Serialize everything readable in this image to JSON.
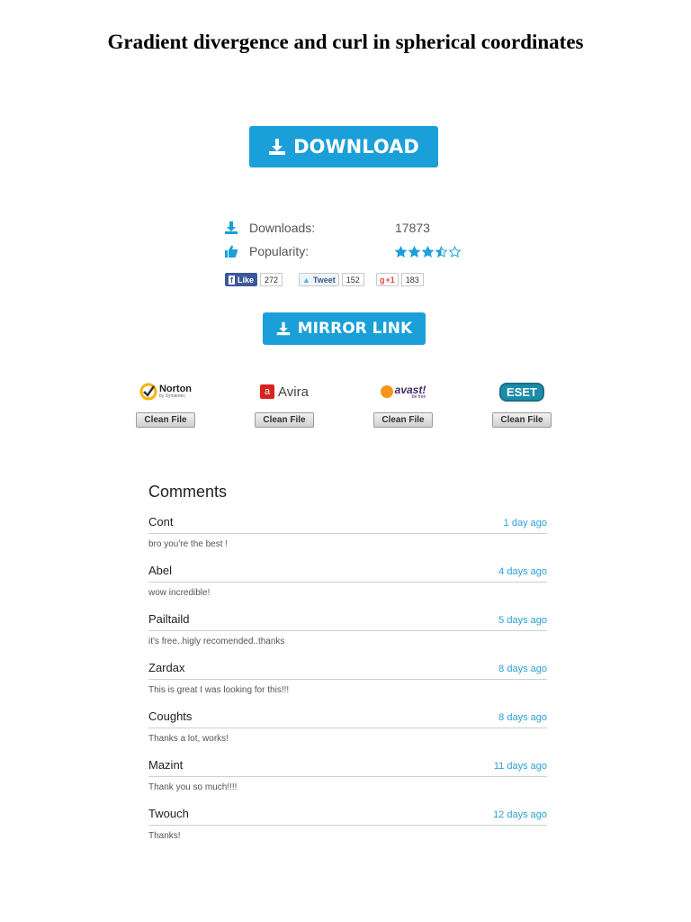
{
  "header": {
    "title": "Gradient divergence and curl in spherical coordinates"
  },
  "download_button": {
    "label": "DOWNLOAD",
    "icon": "download-icon",
    "color": "#1a9fd9"
  },
  "stats": {
    "downloads_label": "Downloads:",
    "downloads_value": "17873",
    "popularity_label": "Popularity:",
    "popularity_rating": 3.5,
    "popularity_max": 5
  },
  "social": {
    "facebook": {
      "label": "Like",
      "count": "272"
    },
    "twitter": {
      "label": "Tweet",
      "count": "152"
    },
    "google": {
      "label": "+1",
      "count": "183"
    }
  },
  "mirror_button": {
    "label": "MIRROR LINK",
    "icon": "download-icon"
  },
  "antivirus": [
    {
      "name": "Norton",
      "sub": "by Symantec",
      "button": "Clean File"
    },
    {
      "name": "Avira",
      "button": "Clean File"
    },
    {
      "name": "avast!",
      "sub": "be free",
      "button": "Clean File"
    },
    {
      "name": "ESET",
      "button": "Clean File"
    }
  ],
  "comments": {
    "title": "Comments",
    "items": [
      {
        "author": "Cont",
        "time": "1 day ago",
        "text": "bro you're the best !"
      },
      {
        "author": "Abel",
        "time": "4 days ago",
        "text": "wow incredible!"
      },
      {
        "author": "Pailtaild",
        "time": "5 days ago",
        "text": "it's free..higly recomended..thanks"
      },
      {
        "author": "Zardax",
        "time": "8 days ago",
        "text": "This is great I was looking for this!!!"
      },
      {
        "author": "Coughts",
        "time": "8 days ago",
        "text": "Thanks a lot, works!"
      },
      {
        "author": "Mazint",
        "time": "11 days ago",
        "text": "Thank you so much!!!!"
      },
      {
        "author": "Twouch",
        "time": "12 days ago",
        "text": "Thanks!"
      }
    ]
  }
}
